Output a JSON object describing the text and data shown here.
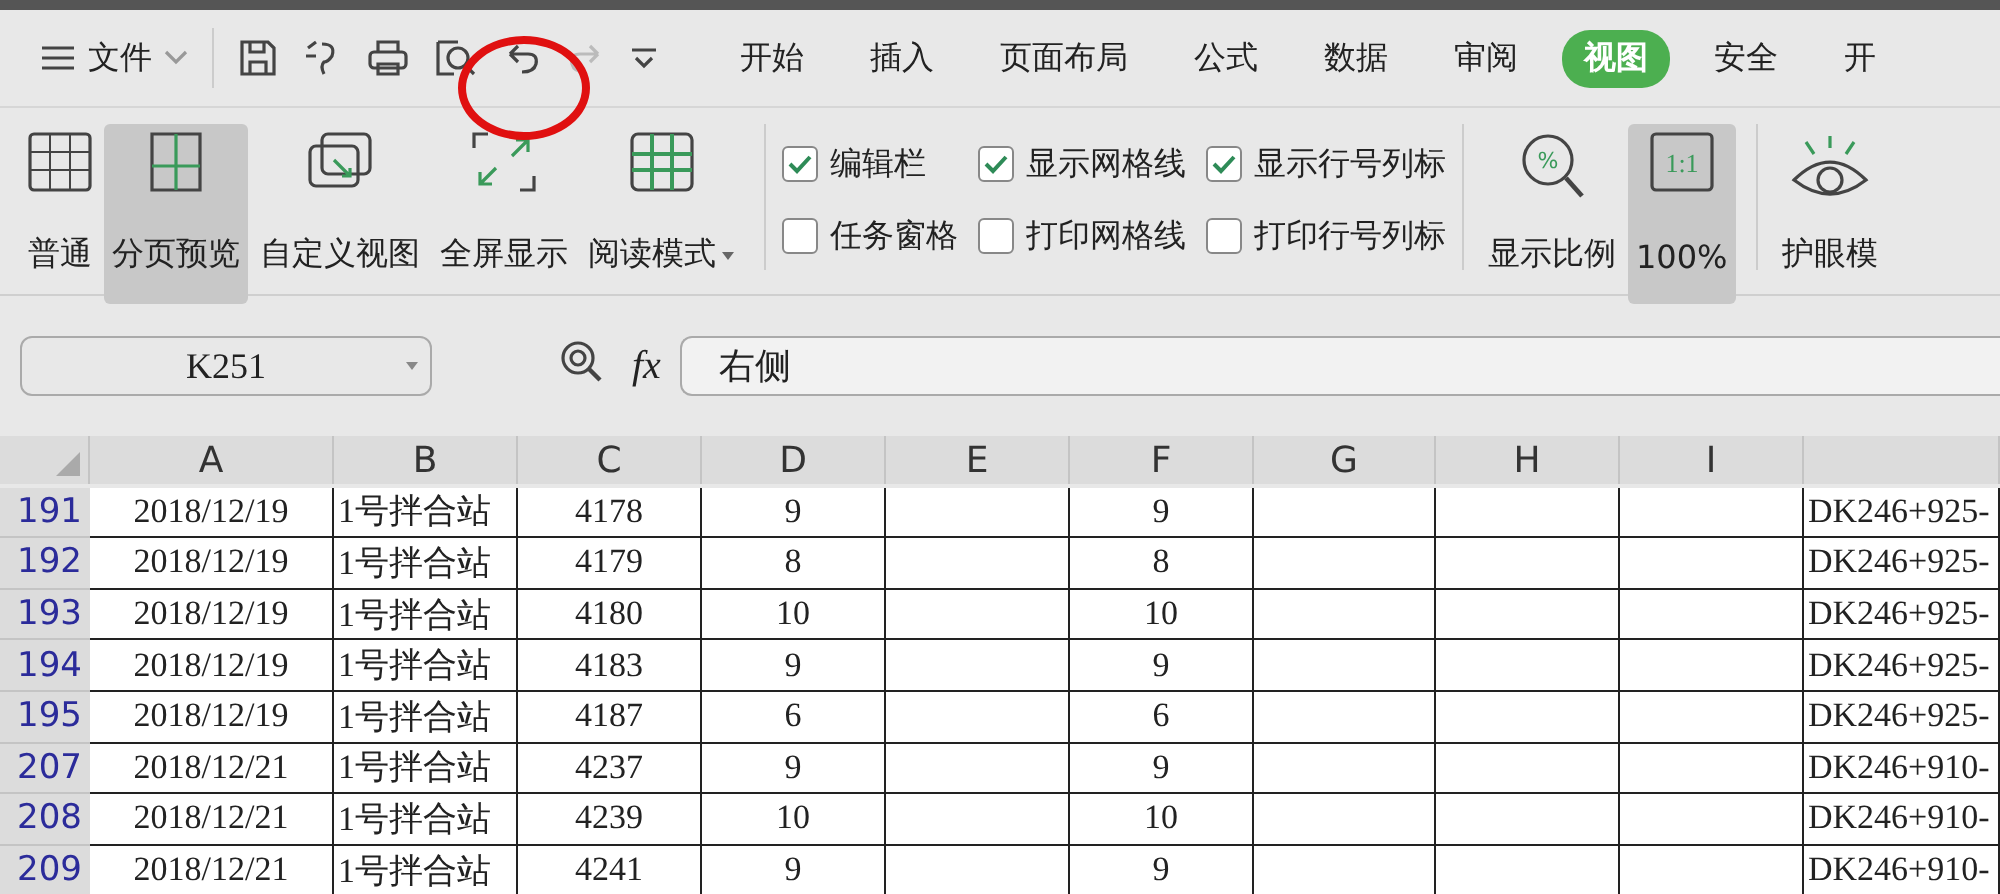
{
  "menu": {
    "file": "文件",
    "tabs": [
      {
        "label": "开始",
        "selected": false
      },
      {
        "label": "插入",
        "selected": false
      },
      {
        "label": "页面布局",
        "selected": false
      },
      {
        "label": "公式",
        "selected": false
      },
      {
        "label": "数据",
        "selected": false
      },
      {
        "label": "审阅",
        "selected": false
      },
      {
        "label": "视图",
        "selected": true
      },
      {
        "label": "安全",
        "selected": false
      },
      {
        "label": "开",
        "selected": false
      }
    ]
  },
  "ribbon": {
    "view_buttons": [
      {
        "kind": "normal",
        "label": "普通",
        "selected": false
      },
      {
        "kind": "pagebreak",
        "label": "分页预览",
        "selected": true
      },
      {
        "kind": "custom",
        "label": "自定义视图",
        "selected": false
      },
      {
        "kind": "fullscreen",
        "label": "全屏显示",
        "selected": false
      },
      {
        "kind": "reading",
        "label": "阅读模式",
        "selected": false
      }
    ],
    "checkboxes": [
      {
        "label": "编辑栏",
        "checked": true
      },
      {
        "label": "任务窗格",
        "checked": false
      },
      {
        "label": "显示网格线",
        "checked": true
      },
      {
        "label": "打印网格线",
        "checked": false
      },
      {
        "label": "显示行号列标",
        "checked": true
      },
      {
        "label": "打印行号列标",
        "checked": false
      }
    ],
    "zoom_buttons": [
      {
        "kind": "zoom",
        "icon_text": "%",
        "label": "显示比例",
        "selected": false
      },
      {
        "kind": "actual",
        "icon_text": "1:1",
        "label": "100%",
        "selected": true
      },
      {
        "kind": "eye",
        "label": "护眼模",
        "selected": false
      }
    ]
  },
  "formula_bar": {
    "cell_ref": "K251",
    "fx": "fx",
    "value": "右侧"
  },
  "sheet": {
    "columns": [
      "A",
      "B",
      "C",
      "D",
      "E",
      "F",
      "G",
      "H",
      "I"
    ],
    "rows": [
      {
        "row": "191",
        "cells": {
          "A": "2018/12/19",
          "B": "1号拌合站",
          "C": "4178",
          "D": "9",
          "F": "9",
          "column_10": "DK246+925-"
        }
      },
      {
        "row": "192",
        "cells": {
          "A": "2018/12/19",
          "B": "1号拌合站",
          "C": "4179",
          "D": "8",
          "F": "8",
          "column_10": "DK246+925-"
        }
      },
      {
        "row": "193",
        "cells": {
          "A": "2018/12/19",
          "B": "1号拌合站",
          "C": "4180",
          "D": "10",
          "F": "10",
          "column_10": "DK246+925-"
        }
      },
      {
        "row": "194",
        "cells": {
          "A": "2018/12/19",
          "B": "1号拌合站",
          "C": "4183",
          "D": "9",
          "F": "9",
          "column_10": "DK246+925-"
        }
      },
      {
        "row": "195",
        "cells": {
          "A": "2018/12/19",
          "B": "1号拌合站",
          "C": "4187",
          "D": "6",
          "F": "6",
          "column_10": "DK246+925-"
        }
      },
      {
        "row": "207",
        "cells": {
          "A": "2018/12/21",
          "B": "1号拌合站",
          "C": "4237",
          "D": "9",
          "F": "9",
          "column_10": "DK246+910-"
        }
      },
      {
        "row": "208",
        "cells": {
          "A": "2018/12/21",
          "B": "1号拌合站",
          "C": "4239",
          "D": "10",
          "F": "10",
          "column_10": "DK246+910-"
        }
      },
      {
        "row": "209",
        "cells": {
          "A": "2018/12/21",
          "B": "1号拌合站",
          "C": "4241",
          "D": "9",
          "F": "9",
          "column_10": "DK246+910-"
        }
      }
    ]
  }
}
